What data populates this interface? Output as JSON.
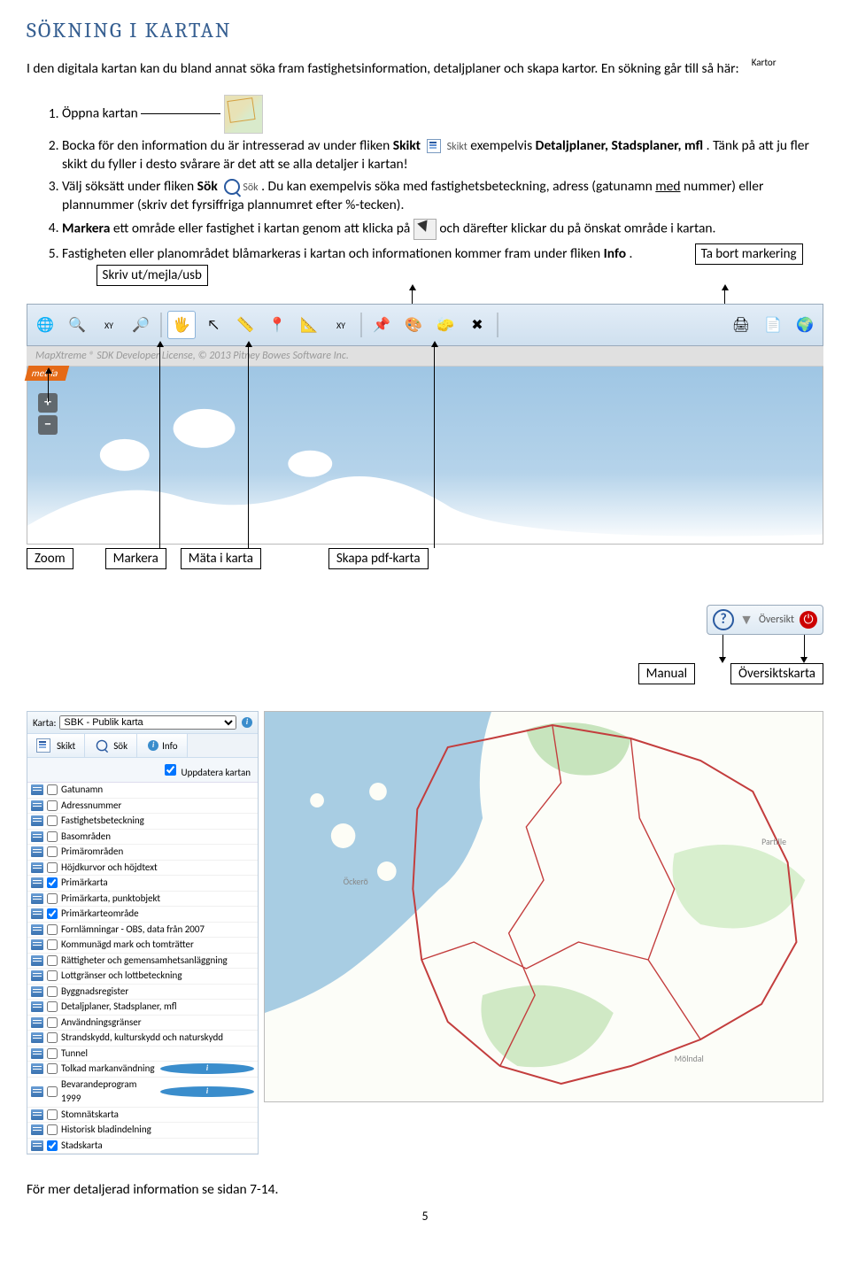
{
  "heading": "SÖKNING I KARTAN",
  "intro_part1": "I den digitala kartan kan du bland annat söka fram fastighetsinformation, detaljplaner och skapa kartor. En sökning går till så här:",
  "kartor_thumb_label": "Kartor",
  "steps": {
    "s1": "Öppna kartan",
    "s2a": "Bocka för den information du är intresserad av under fliken ",
    "s2_bold1": "Skikt",
    "s2_skikt_label": "Skikt",
    "s2b": " exempelvis ",
    "s2_bold2": "Detaljplaner, Stadsplaner, mfl",
    "s2c": ". Tänk på att ju fler skikt du fyller i desto svårare är det att se alla detaljer i kartan!",
    "s3a": "Välj söksätt under fliken ",
    "s3_bold": "Sök",
    "s3_sok_label": "Sök",
    "s3b": " . Du kan exempelvis söka med fastighetsbeteckning, adress (gatunamn ",
    "s3_underline": "med",
    "s3c": " nummer) eller plannummer (skriv det fyrsiffriga plannumret efter %-tecken).",
    "s4_bold": "Markera",
    "s4a": " ett område eller fastighet i kartan genom att klicka på ",
    "s4b": "   och därefter klickar du på önskat område i kartan.",
    "s5a": "Fastigheten eller planområdet blåmarkeras i kartan och informationen kommer fram under fliken ",
    "s5_bold": "Info",
    "s5b": "."
  },
  "callouts": {
    "remove": "Ta bort markering",
    "print": "Skriv ut/mejla/usb",
    "zoom": "Zoom",
    "mark": "Markera",
    "measure": "Mäta i karta",
    "pdf": "Skapa pdf-karta",
    "manual": "Manual",
    "overview": "Översiktskarta"
  },
  "toolbar_xy": "XY",
  "watermark": "MapXtreme ® SDK Developer License, © 2013 Pitney Bowes Software Inc.",
  "metria": "metria",
  "overview_label": "Översikt",
  "sidepanel": {
    "karta_label": "Karta:",
    "karta_value": "SBK - Publik karta",
    "tabs": {
      "skikt": "Skikt",
      "sok": "Sök",
      "info": "Info"
    },
    "update": "Uppdatera kartan",
    "layers": [
      {
        "label": "Gatunamn",
        "checked": false,
        "info": false
      },
      {
        "label": "Adressnummer",
        "checked": false,
        "info": false
      },
      {
        "label": "Fastighetsbeteckning",
        "checked": false,
        "info": false
      },
      {
        "label": "Basområden",
        "checked": false,
        "info": false
      },
      {
        "label": "Primärområden",
        "checked": false,
        "info": false
      },
      {
        "label": "Höjdkurvor och höjdtext",
        "checked": false,
        "info": false
      },
      {
        "label": "Primärkarta",
        "checked": true,
        "info": false
      },
      {
        "label": "Primärkarta, punktobjekt",
        "checked": false,
        "info": false
      },
      {
        "label": "Primärkarteområde",
        "checked": true,
        "info": false
      },
      {
        "label": "Fornlämningar - OBS, data från 2007",
        "checked": false,
        "info": false
      },
      {
        "label": "Kommunägd mark och tomträtter",
        "checked": false,
        "info": false
      },
      {
        "label": "Rättigheter och gemensamhetsanläggning",
        "checked": false,
        "info": false
      },
      {
        "label": "Lottgränser och lottbeteckning",
        "checked": false,
        "info": false
      },
      {
        "label": "Byggnadsregister",
        "checked": false,
        "info": false
      },
      {
        "label": "Detaljplaner, Stadsplaner, mfl",
        "checked": false,
        "info": false
      },
      {
        "label": "Användningsgränser",
        "checked": false,
        "info": false
      },
      {
        "label": "Strandskydd, kulturskydd och naturskydd",
        "checked": false,
        "info": false
      },
      {
        "label": "Tunnel",
        "checked": false,
        "info": false
      },
      {
        "label": "Tolkad markanvändning",
        "checked": false,
        "info": true
      },
      {
        "label": "Bevarandeprogram 1999",
        "checked": false,
        "info": true
      },
      {
        "label": "Stomnätskarta",
        "checked": false,
        "info": false
      },
      {
        "label": "Historisk bladindelning",
        "checked": false,
        "info": false
      },
      {
        "label": "Stadskarta",
        "checked": true,
        "info": false
      }
    ]
  },
  "bigmap_labels": [
    "Öckerö",
    "Partille",
    "Mölndal"
  ],
  "footer": "För mer detaljerad information se sidan 7-14.",
  "page": "5"
}
